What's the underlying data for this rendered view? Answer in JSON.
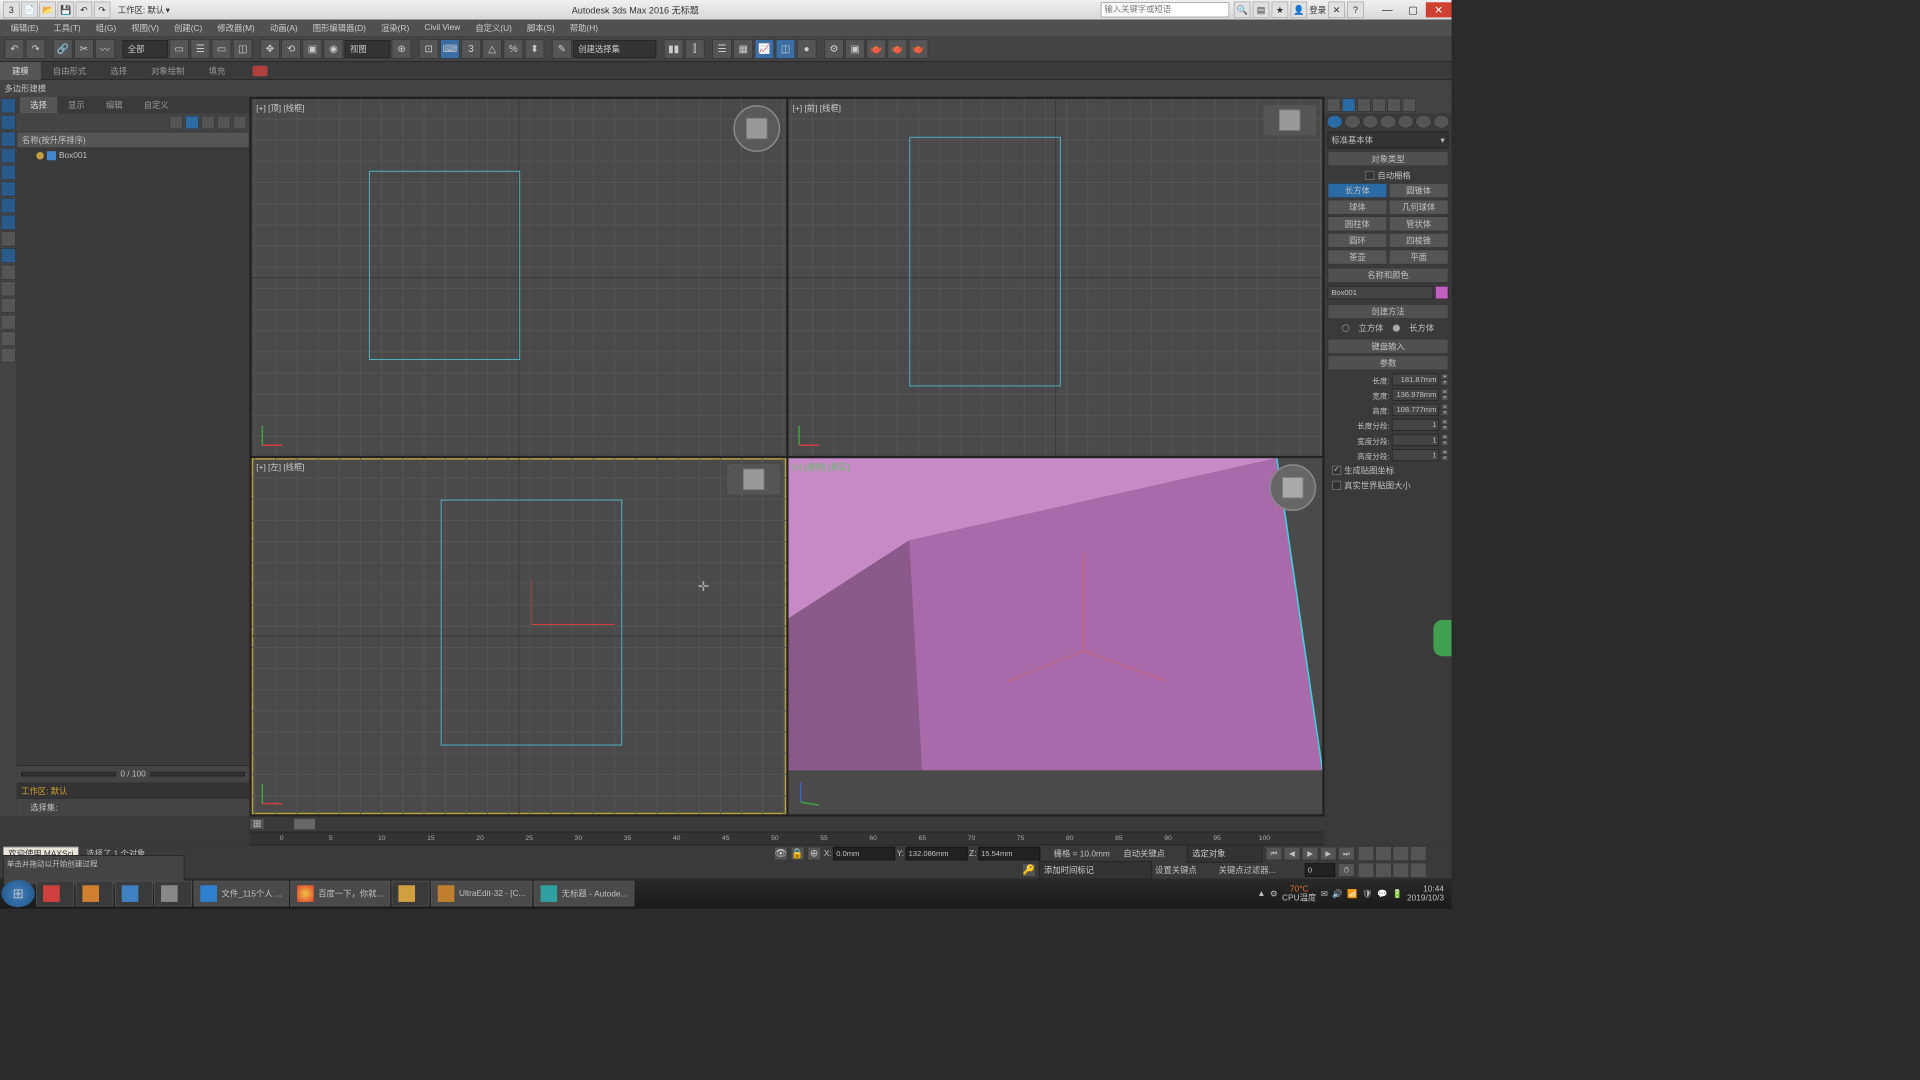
{
  "titlebar": {
    "workspace_label": "工作区: 默认",
    "app_title": "Autodesk 3ds Max 2016    无标题",
    "search_placeholder": "输入关键字或短语",
    "signin": "登录"
  },
  "menubar": {
    "items": [
      "编辑(E)",
      "工具(T)",
      "组(G)",
      "视图(V)",
      "创建(C)",
      "修改器(M)",
      "动画(A)",
      "图形编辑器(D)",
      "渲染(R)",
      "Civil View",
      "自定义(U)",
      "脚本(S)",
      "帮助(H)"
    ]
  },
  "toolbar": {
    "selection_dd": "全部",
    "view_dd": "视图",
    "named_sel": "创建选择集"
  },
  "ribbon": {
    "tabs": [
      "建模",
      "自由形式",
      "选择",
      "对象绘制",
      "填充"
    ],
    "active": 0,
    "sub_label": "多边形建模"
  },
  "sub_tabs": {
    "items": [
      "选择",
      "显示",
      "编辑",
      "自定义"
    ],
    "active": 0
  },
  "scene_explorer": {
    "header": "名称(按升序排序)",
    "items": [
      {
        "name": "Box001"
      }
    ],
    "frame_display": "0 / 100",
    "workspace_footer": "工作区: 默认",
    "sel_set_label": "选择集:"
  },
  "viewports": {
    "top": "[+] [顶] [线框]",
    "front": "[+] [前] [线框]",
    "left": "[+] [左] [线框]",
    "persp": "[+] [透视] [真实]"
  },
  "command_panel": {
    "dropdown": "标准基本体",
    "rollouts": {
      "object_type": {
        "title": "对象类型",
        "autogrid": "自动栅格",
        "prims": [
          "长方体",
          "圆锥体",
          "球体",
          "几何球体",
          "圆柱体",
          "管状体",
          "圆环",
          "四棱锥",
          "茶壶",
          "平面"
        ],
        "active": 0
      },
      "name_color": {
        "title": "名称和颜色",
        "name": "Box001",
        "color": "#c060c0"
      },
      "creation": {
        "title": "创建方法",
        "opts": [
          "立方体",
          "长方体"
        ],
        "selected": 1
      },
      "keyboard": {
        "title": "键盘输入"
      },
      "params": {
        "title": "参数",
        "length_lbl": "长度:",
        "length": "181.87mm",
        "width_lbl": "宽度:",
        "width": "136.978mm",
        "height_lbl": "高度:",
        "height": "108.777mm",
        "lseg_lbl": "长度分段:",
        "lseg": "1",
        "wseg_lbl": "宽度分段:",
        "wseg": "1",
        "hseg_lbl": "高度分段:",
        "hseg": "1",
        "gen_map": "生成贴图坐标",
        "real_world": "真实世界贴图大小"
      }
    }
  },
  "timeline": {
    "current": "0",
    "ticks": [
      "0",
      "5",
      "10",
      "15",
      "20",
      "25",
      "30",
      "35",
      "40",
      "45",
      "50",
      "55",
      "60",
      "65",
      "70",
      "75",
      "80",
      "85",
      "90",
      "95",
      "100"
    ]
  },
  "status": {
    "selection_info": "选择了 1 个对象",
    "prompt": "单击并拖动以开始创建过程",
    "welcome": "欢迎使用 MAXSci",
    "x_lbl": "X:",
    "x": "0.0mm",
    "y_lbl": "Y:",
    "y": "132.086mm",
    "z_lbl": "Z:",
    "z": "15.54mm",
    "grid": "栅格 = 10.0mm",
    "add_time_tag": "添加时间标记",
    "autokey": "自动关键点",
    "setkey": "设置关键点",
    "sel_obj": "选定对象",
    "keyfilter": "关键点过滤器..."
  },
  "taskbar": {
    "items": [
      {
        "label": ""
      },
      {
        "label": ""
      },
      {
        "label": ""
      },
      {
        "label": ""
      },
      {
        "label": "文件_115个人 ..."
      },
      {
        "label": "百度一下，你就..."
      },
      {
        "label": ""
      },
      {
        "label": "UltraEdit-32 - [C..."
      },
      {
        "label": "无标题 - Autode..."
      }
    ],
    "temp": "70°C",
    "temp_lbl": "CPU温度",
    "time": "10:44",
    "date": "2019/10/3"
  }
}
